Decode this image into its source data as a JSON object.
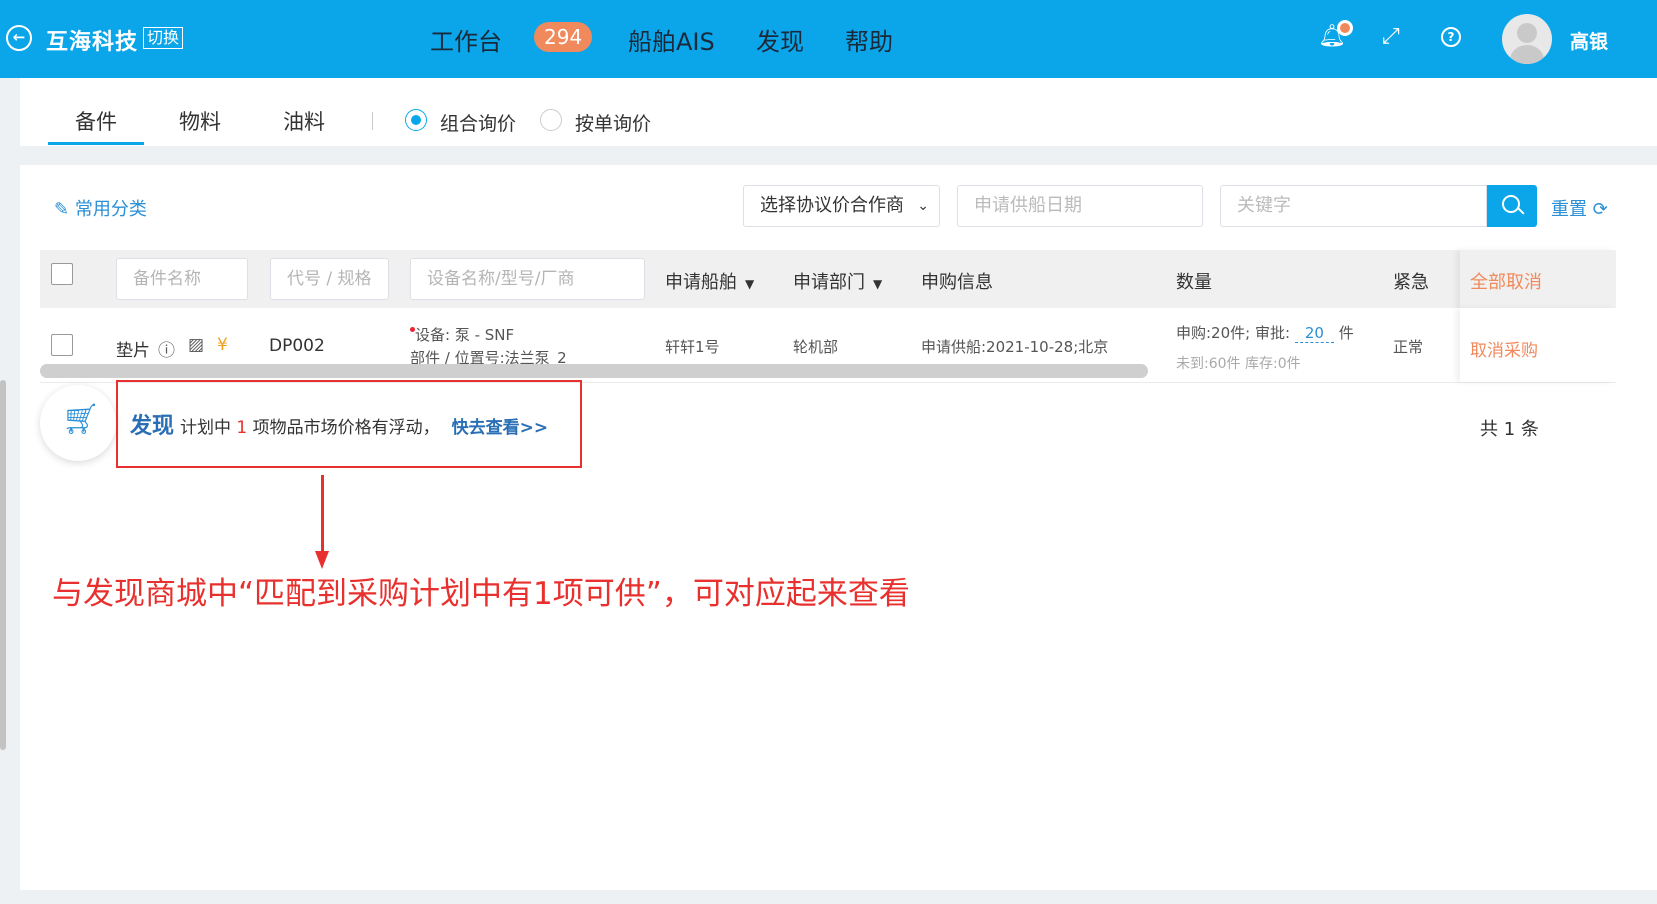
{
  "header": {
    "brand": "互海科技",
    "switch_label": "切换",
    "nav": [
      {
        "label": "工作台",
        "badge": "294"
      },
      {
        "label": "船舶AIS"
      },
      {
        "label": "发现"
      },
      {
        "label": "帮助"
      }
    ],
    "username": "高银",
    "icons": [
      "back-icon",
      "bell-icon",
      "fullscreen-icon",
      "help-icon",
      "avatar"
    ]
  },
  "tabs": {
    "items": [
      "备件",
      "物料",
      "油料"
    ],
    "active": "备件",
    "radio_options": [
      {
        "label": "组合询价",
        "checked": true
      },
      {
        "label": "按单询价",
        "checked": false
      }
    ]
  },
  "toolbar": {
    "common_category": "常用分类",
    "supplier_select": "选择协议价合作商",
    "date_placeholder": "申请供船日期",
    "keyword_placeholder": "关键字",
    "reset_label": "重置"
  },
  "table": {
    "filters": {
      "name": "备件名称",
      "code": "代号 / 规格",
      "equipment": "设备名称/型号/厂商"
    },
    "headers": {
      "ship": "申请船舶",
      "dept": "申请部门",
      "info": "申购信息",
      "qty": "数量",
      "urgency": "紧急",
      "cancel_all": "全部取消"
    },
    "rows": [
      {
        "name": "垫片",
        "code": "DP002",
        "equipment_line1": "设备: 泵 - SNF",
        "equipment_line2": "部件 / 位置号:法兰泵_2",
        "ship": "轩轩1号",
        "dept": "轮机部",
        "info": "申请供船:2021-10-28;北京",
        "qty_prefix": "申购:20件; 审批:",
        "qty_approved": "20",
        "qty_unit": "件",
        "qty_sub": "未到:60件 库存:0件",
        "urgency": "正常",
        "action": "取消采购"
      }
    ]
  },
  "discover": {
    "title": "发现",
    "text_before": "计划中",
    "count": "1",
    "text_after": "项物品市场价格有浮动，",
    "link": "快去查看>>"
  },
  "total": "共 1 条",
  "annotation": "与发现商城中“匹配到采购计划中有1项可供”，可对应起来查看",
  "colors": {
    "primary": "#0aa6e9",
    "badge": "#f08a5d",
    "link": "#2a8fd6",
    "annotation": "#e8312e"
  }
}
